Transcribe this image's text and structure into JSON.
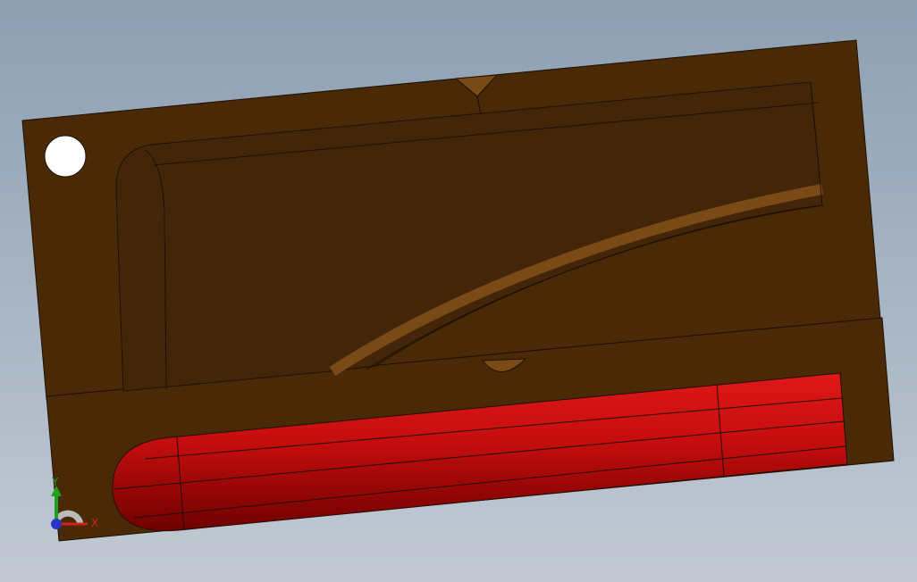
{
  "viewport": {
    "background_top": "#8d9fb2",
    "background_bottom": "#c2c9d3"
  },
  "model": {
    "mold_color": "#4a2a06",
    "mold_face_color": "#43260a",
    "mold_edge_color": "#1e1002",
    "cavity_highlight_color": "#7a4a16",
    "part_color": "#c40d0d",
    "part_shadow_color": "#6e0000",
    "part_highlight_color": "#e01818",
    "hole_color": "#ffffff"
  },
  "triad": {
    "x_label": "X",
    "y_label": "Y",
    "x_color": "#d42020",
    "y_color": "#1fa31f",
    "z_color": "#2a34c8"
  }
}
